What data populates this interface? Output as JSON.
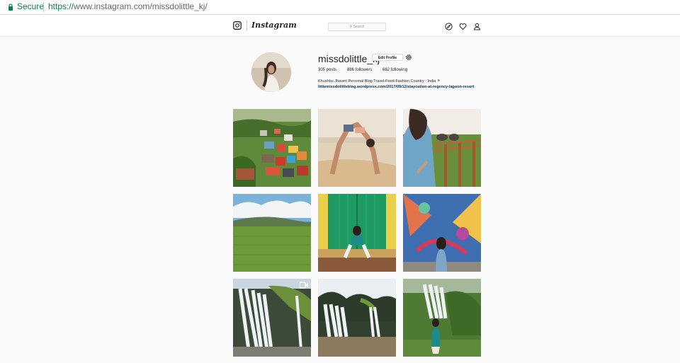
{
  "browser": {
    "secure_label": "Secure",
    "url_scheme": "https://",
    "url_rest": "www.instagram.com/missdolittle_kj/"
  },
  "nav": {
    "wordmark": "Instagram",
    "search_placeholder": "Search",
    "icons": [
      "instagram-glyph-icon",
      "compass-icon",
      "heart-icon",
      "person-icon"
    ]
  },
  "profile": {
    "username": "missdolittle_kj",
    "edit_label": "Edit Profile",
    "posts": "305 posts",
    "followers": "886 followers",
    "following": "662 following",
    "bio_text": "Khushbu Jhaveri Personal Blog Travel-Food-Fashion Country : India",
    "bio_link": "littlemissdolittleblog.wordpress.com/2017/09/12/staycation-at-regency-lagoon-resort"
  },
  "posts": [
    {
      "label": "hill town colorful houses"
    },
    {
      "label": "backbend yoga on beach"
    },
    {
      "label": "woman near elephants"
    },
    {
      "label": "green rice paddy field"
    },
    {
      "label": "woman at green door"
    },
    {
      "label": "woman before mural"
    },
    {
      "label": "waterfall video",
      "video": true
    },
    {
      "label": "waterfall in forest"
    },
    {
      "label": "woman at waterfall"
    }
  ],
  "colors": {
    "secure": "#0b8043",
    "link": "#003569",
    "background": "#fafafa"
  }
}
